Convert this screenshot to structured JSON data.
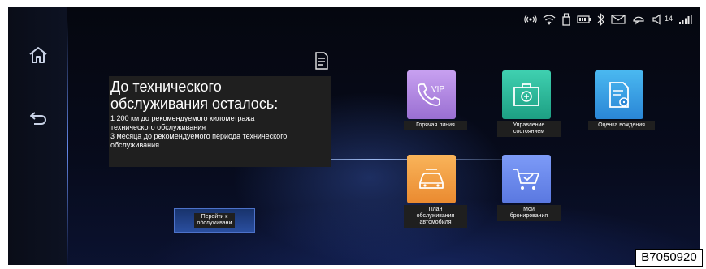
{
  "status_bar": {
    "icons": [
      "signal-broadcast-icon",
      "wifi-icon",
      "usb-icon",
      "battery-icon",
      "bluetooth-icon",
      "mail-icon",
      "chat-icon",
      "volume-icon",
      "cellular-signal-icon"
    ],
    "volume_level": "14"
  },
  "sidebar": {
    "items": [
      {
        "icon": "home-icon"
      },
      {
        "icon": "back-icon"
      }
    ]
  },
  "info_panel": {
    "title_line1": "До технического",
    "title_line2": "обслуживания осталось:",
    "km_line1": "1 200 км до рекомендуемого километража",
    "km_line2": "технического обслуживания",
    "months_line1": "3 месяца до рекомендуемого периода технического",
    "months_line2": "обслуживания"
  },
  "goto_button": {
    "line1": "Перейти к",
    "line2": "обслуживани"
  },
  "apps": [
    {
      "line1": "Горячая линия",
      "line2": "",
      "line3": "",
      "icon": "phone-vip-icon",
      "color": "#b78be0"
    },
    {
      "line1": "Управление",
      "line2": "состоянием",
      "line3": "",
      "icon": "medical-kit-icon",
      "color": "#2fbf9f"
    },
    {
      "line1": "Оценка вождения",
      "line2": "",
      "line3": "",
      "icon": "report-steering-icon",
      "color": "#3ba6e6"
    },
    {
      "line1": "План",
      "line2": "обслуживания",
      "line3": "автомобиля",
      "icon": "car-service-icon",
      "color": "#f4a24a"
    },
    {
      "line1": "Мои",
      "line2": "бронирования",
      "line3": "",
      "icon": "shopping-cart-icon",
      "color": "#6f8ff0"
    }
  ],
  "figure_code": "B7050920"
}
